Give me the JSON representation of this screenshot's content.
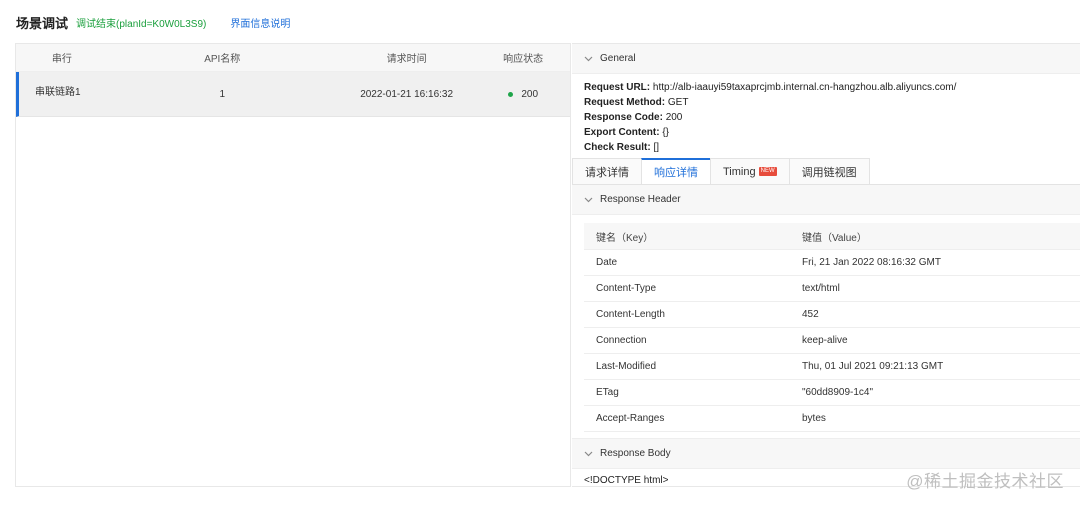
{
  "header": {
    "title": "场景调试",
    "status": "调试结束(planId=K0W0L3S9)",
    "info_link": "界面信息说明"
  },
  "left_table": {
    "columns": [
      "串行",
      "API名称",
      "请求时间",
      "响应状态"
    ],
    "rows": [
      {
        "name": "串联链路1",
        "api_count": "1",
        "time": "2022-01-21 16:16:32",
        "status": "200"
      }
    ]
  },
  "general": {
    "section_title": "General",
    "request_url_label": "Request URL:",
    "request_url": "http://alb-iaauyi59taxaprcjmb.internal.cn-hangzhou.alb.aliyuncs.com/",
    "request_method_label": "Request Method:",
    "request_method": "GET",
    "response_code_label": "Response Code:",
    "response_code": "200",
    "export_content_label": "Export Content:",
    "export_content": "{}",
    "check_result_label": "Check Result:",
    "check_result": "[]"
  },
  "tabs": {
    "request_detail": "请求详情",
    "response_detail": "响应详情",
    "timing": "Timing",
    "timing_badge": "NEW",
    "trace_view": "调用链视图"
  },
  "response_header": {
    "section_title": "Response Header",
    "key_col": "键名（Key）",
    "value_col": "键值（Value）",
    "rows": [
      {
        "key": "Date",
        "value": "Fri, 21 Jan 2022 08:16:32 GMT"
      },
      {
        "key": "Content-Type",
        "value": "text/html"
      },
      {
        "key": "Content-Length",
        "value": "452"
      },
      {
        "key": "Connection",
        "value": "keep-alive"
      },
      {
        "key": "Last-Modified",
        "value": "Thu, 01 Jul 2021 09:21:13 GMT"
      },
      {
        "key": "ETag",
        "value": "\"60dd8909-1c4\""
      },
      {
        "key": "Accept-Ranges",
        "value": "bytes"
      }
    ]
  },
  "response_body": {
    "section_title": "Response Body",
    "content": "<!DOCTYPE html>"
  },
  "watermark": "@稀土掘金技术社区",
  "colors": {
    "accent": "#1f6fd9",
    "success": "#1fa54a",
    "status_text": "#1a9f3c",
    "badge": "#e74c3c"
  },
  "icons": [
    "chevron-down-icon",
    "status-dot-icon"
  ]
}
